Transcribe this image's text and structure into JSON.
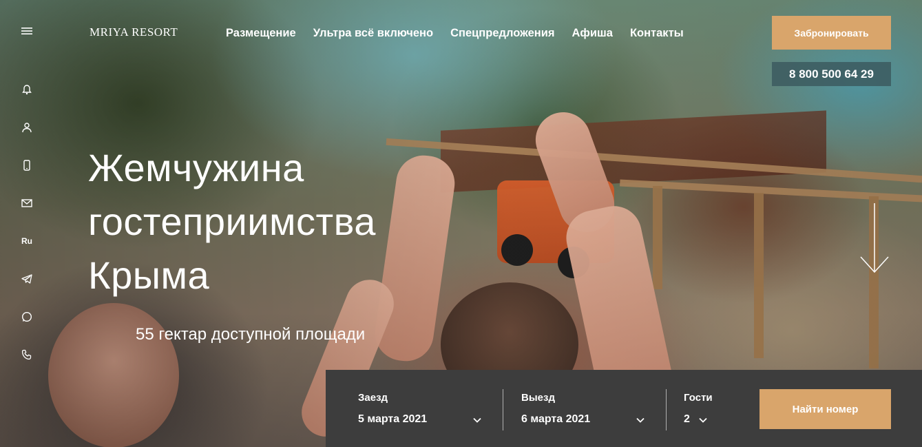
{
  "brand": {
    "logo_text": "MRIYA RESORT"
  },
  "nav": {
    "items": [
      {
        "label": "Размещение"
      },
      {
        "label": "Ультра всё включено"
      },
      {
        "label": "Спецпредложения"
      },
      {
        "label": "Афиша"
      },
      {
        "label": "Контакты"
      }
    ]
  },
  "header": {
    "book_label": "Забронировать",
    "phone": "8 800 500 64 29"
  },
  "sidebar": {
    "icons": [
      "menu-icon",
      "bell-icon",
      "user-icon",
      "phone-device-icon",
      "mail-icon",
      "telegram-icon",
      "whatsapp-icon",
      "call-icon"
    ],
    "lang": "Ru"
  },
  "hero": {
    "title_lines": [
      "Жемчужина",
      "гостеприимства",
      "Крыма"
    ],
    "subtitle": "55 гектар доступной площади"
  },
  "booking": {
    "checkin_label": "Заезд",
    "checkin_value": "5 марта 2021",
    "checkout_label": "Выезд",
    "checkout_value": "6 марта 2021",
    "guests_label": "Гости",
    "guests_value": "2",
    "find_label": "Найти номер"
  },
  "colors": {
    "accent": "#d9a56b",
    "panel": "#3d3d3d",
    "phone_bg": "#3c5a5f"
  }
}
